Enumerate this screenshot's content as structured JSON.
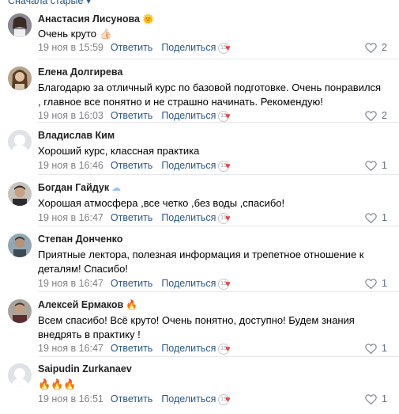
{
  "top_label": "Сначала старые ▾",
  "actions": {
    "reply": "Ответить",
    "share": "Поделиться"
  },
  "comments": [
    {
      "author": "Анастасия Лисунова",
      "badge": "🌞",
      "text": "Очень круто 👍🏻",
      "date": "19 ноя в 15:59",
      "likes": "2",
      "avatar": "photo"
    },
    {
      "author": "Елена Долгирева",
      "badge": "",
      "text": "Благодарю за отличный курс по базовой подготовке. Очень понравился , главное все понятно и не страшно начинать. Рекомендую!",
      "date": "19 ноя в 16:03",
      "likes": "2",
      "avatar": "photo"
    },
    {
      "author": "Владислав Ким",
      "badge": "",
      "text": "Хороший курс, классная практика",
      "date": "19 ноя в 16:46",
      "likes": "1",
      "avatar": "placeholder"
    },
    {
      "author": "Богдан Гайдук",
      "badge": "☁",
      "text": "Хорошая атмосфера ,все четко ,без воды ,спасибо!",
      "date": "19 ноя в 16:47",
      "likes": "1",
      "avatar": "photo"
    },
    {
      "author": "Степан Донченко",
      "badge": "",
      "text": "Приятные лектора, полезная информация и трепетное отношение к деталям! Спасибо!",
      "date": "19 ноя в 16:47",
      "likes": "1",
      "avatar": "photo"
    },
    {
      "author": "Алексей Ермаков",
      "badge": "🔥",
      "text": "Всем спасибо! Всё круто! Очень понятно, доступно! Будем знания внедрять в практику !",
      "date": "19 ноя в 16:47",
      "likes": "1",
      "avatar": "photo"
    },
    {
      "author": "Saipudin Zurkanaev",
      "badge": "",
      "text": "🔥🔥🔥",
      "date": "19 ноя в 16:51",
      "likes": "1",
      "avatar": "placeholder"
    }
  ],
  "icons": {
    "like": "heart-outline-icon",
    "reaction": "sticker-heart-icon"
  },
  "colors": {
    "link": "#2a5885",
    "muted": "#828282",
    "divider": "#e7e8ec"
  }
}
